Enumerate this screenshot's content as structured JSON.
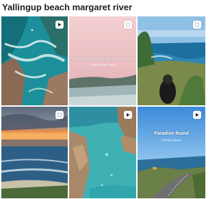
{
  "page": {
    "title": "Yallingup beach margaret river"
  },
  "tiles": [
    {
      "id": "tile-1",
      "kind": "video",
      "icon": "play-icon"
    },
    {
      "id": "tile-2",
      "kind": "photo",
      "icon": "checkbox-icon",
      "caption": "OUR FAVOURITE PLACES TO VISIT",
      "sub": "margaret river region"
    },
    {
      "id": "tile-3",
      "kind": "photo",
      "icon": "checkbox-icon"
    },
    {
      "id": "tile-4",
      "kind": "photo",
      "icon": "checkbox-icon"
    },
    {
      "id": "tile-5",
      "kind": "video",
      "icon": "play-icon"
    },
    {
      "id": "tile-6",
      "kind": "video",
      "icon": "play-icon",
      "caption": "Paradise found",
      "sub": "Yallingup lagoon"
    }
  ],
  "colors": {
    "title": "#1f1f1f",
    "badge": "#ffffff"
  }
}
